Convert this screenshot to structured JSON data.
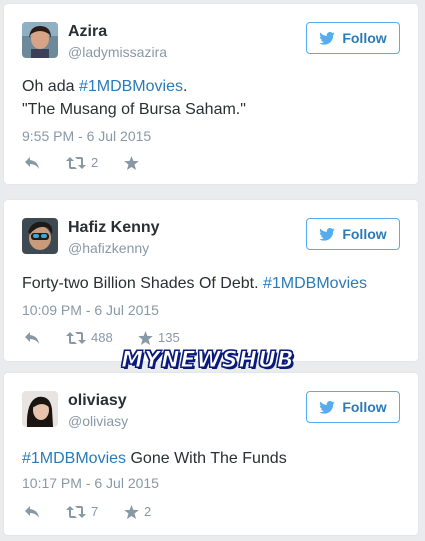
{
  "tweets": [
    {
      "name": "Azira",
      "handle": "@ladymissazira",
      "follow_label": "Follow",
      "text_line1_prefix": "Oh ada ",
      "text_line1_hashtag": "#1MDBMovies",
      "text_line1_suffix": ".",
      "text_line2": "\"The Musang of Bursa Saham.\"",
      "timestamp": "9:55 PM - 6 Jul 2015",
      "retweets": "2",
      "likes": ""
    },
    {
      "name": "Hafiz Kenny",
      "handle": "@hafizkenny",
      "follow_label": "Follow",
      "text_prefix": "Forty-two Billion Shades Of Debt. ",
      "text_hashtag": "#1MDBMovies",
      "timestamp": "10:09 PM - 6 Jul 2015",
      "retweets": "488",
      "likes": "135"
    },
    {
      "name": "oliviasy",
      "handle": "@oliviasy",
      "follow_label": "Follow",
      "text_hashtag": "#1MDBMovies",
      "text_suffix": " Gone With The Funds",
      "timestamp": "10:17 PM - 6 Jul 2015",
      "retweets": "7",
      "likes": "2"
    }
  ],
  "watermark": "MYNEWSHUB",
  "colors": {
    "accent": "#55acee",
    "link": "#2b7bb9",
    "muted": "#8899a6",
    "text": "#292f33"
  }
}
